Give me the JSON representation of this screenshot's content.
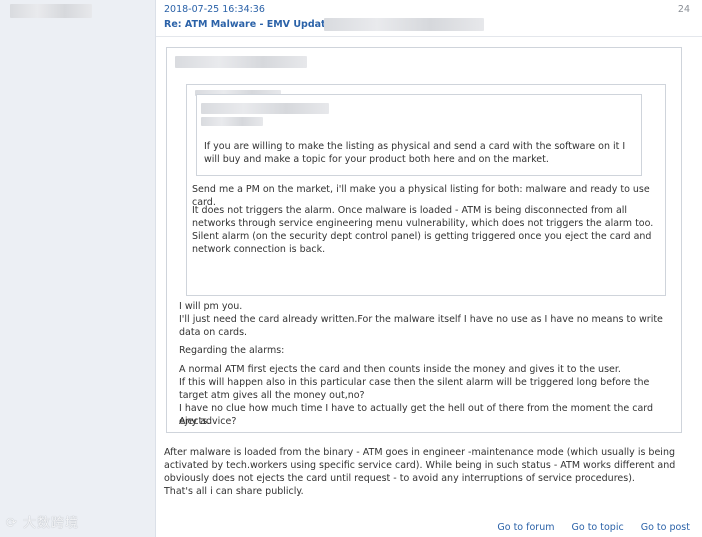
{
  "post": {
    "date": "2018-07-25 16:34:36",
    "subject": "Re: ATM Malware - EMV Update!",
    "number": "24"
  },
  "quote3": {
    "text": "If you are willing to make the listing as physical and send a card with the software on it I will buy and make a topic for your product both here and on the market."
  },
  "quote2": {
    "p1": "Send me a PM on the market, i'll make you a physical listing for both: malware and ready to use card.",
    "p2": "It does not triggers the alarm. Once malware is loaded - ATM is being disconnected from all networks through service engineering menu vulnerability, which does not triggers the alarm too.",
    "p3": "Silent alarm (on the security dept control panel) is getting triggered once you eject the card and network connection is back."
  },
  "quote1": {
    "p1": "I will pm you.",
    "p2": "I'll just need the card already written.For the malware itself I have no use as I have no means to write data on cards.",
    "p3": "Regarding the alarms:",
    "p4": "A normal ATM first ejects the card and then counts inside the money and gives it to the user.",
    "p5": "If this will happen also in this particular case then the silent alarm will be triggered long before the target atm gives all the money out,no?",
    "p6": "I have no clue how much time I have to actually get the hell out of there from the moment the card ejects.",
    "p7": "Any advice?"
  },
  "reply": {
    "p1": "After malware is loaded from the binary - ATM goes in engineer -maintenance mode (which usually is being activated by tech.workers using specific service card). While being in such status - ATM works different and obviously does not ejects the card until request - to avoid any interruptions of service procedures).",
    "p2": "That's all i can share publicly."
  },
  "links": {
    "forum": "Go to forum",
    "topic": "Go to topic",
    "post": "Go to post"
  },
  "watermark": "大数跨境",
  "colors": {
    "link": "#2b62a8",
    "sidebar": "#eceff4",
    "border": "#cfd4db"
  }
}
